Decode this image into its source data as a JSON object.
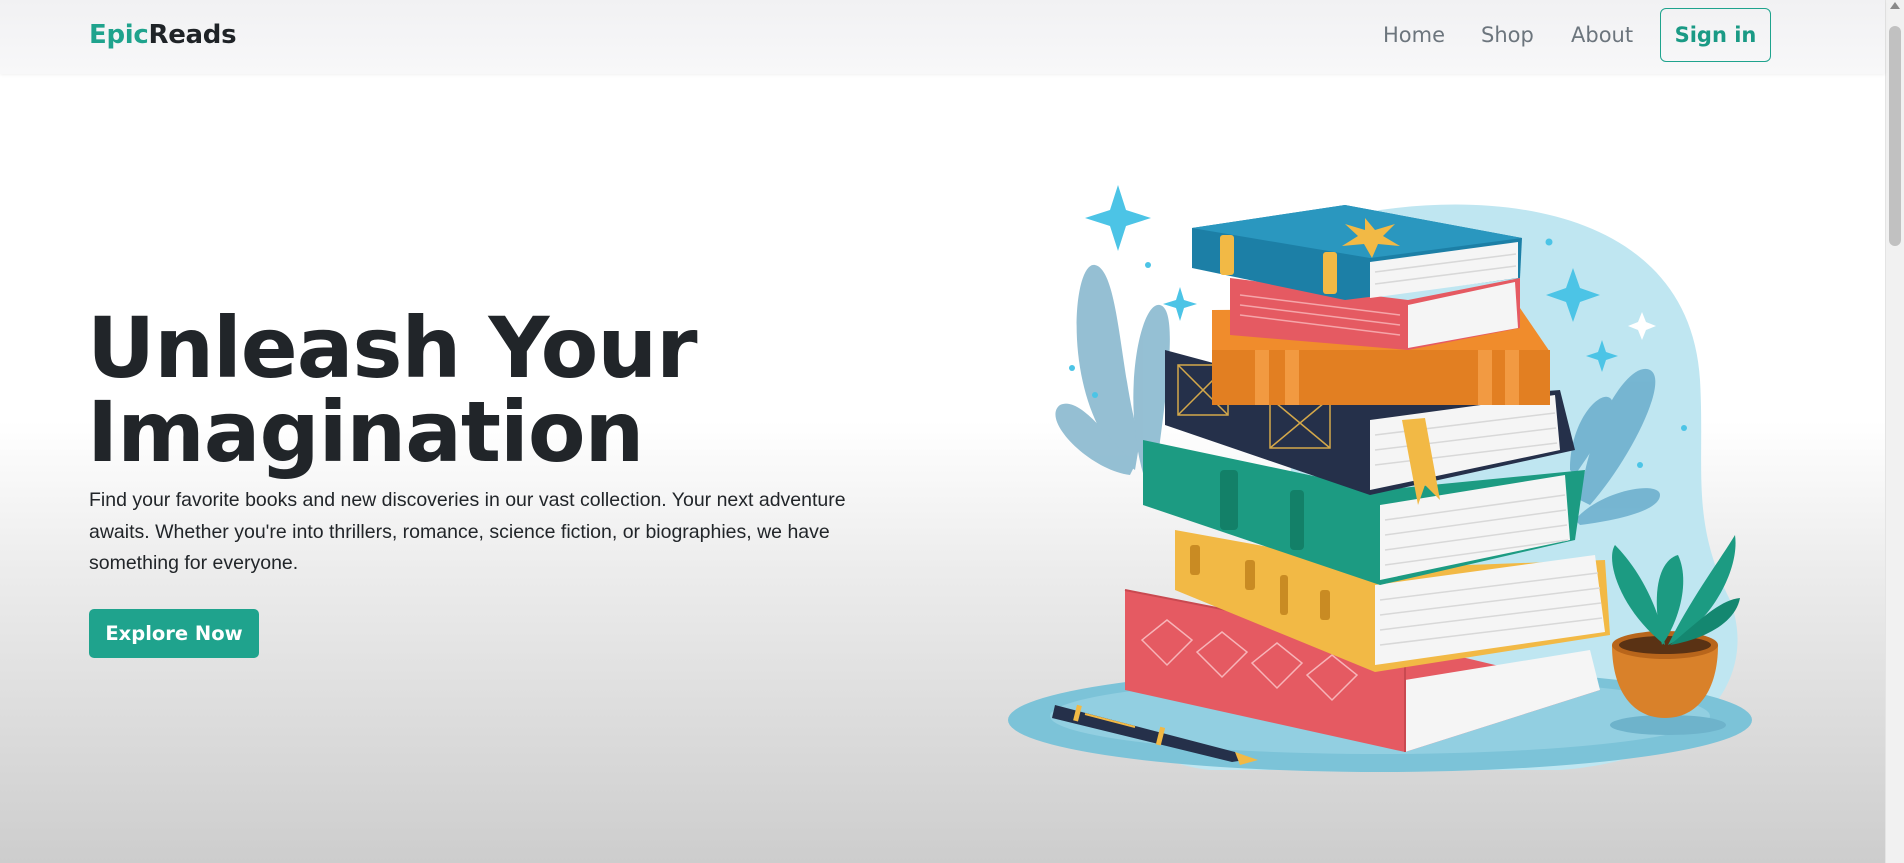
{
  "brand": {
    "part1": "Epic",
    "part2": "Reads"
  },
  "nav": {
    "home": "Home",
    "shop": "Shop",
    "about": "About",
    "signin": "Sign in"
  },
  "hero": {
    "title": "Unleash Your Imagination",
    "description": "Find your favorite books and new discoveries in our vast collection. Your next adventure awaits. Whether you're into thrillers, romance, science fiction, or biographies, we have something for everyone.",
    "cta": "Explore Now"
  },
  "colors": {
    "accent": "#1fa38d",
    "text_dark": "#212529",
    "text_muted": "#6c757d"
  },
  "icons": {
    "illustration": "book-stack-illustration"
  }
}
